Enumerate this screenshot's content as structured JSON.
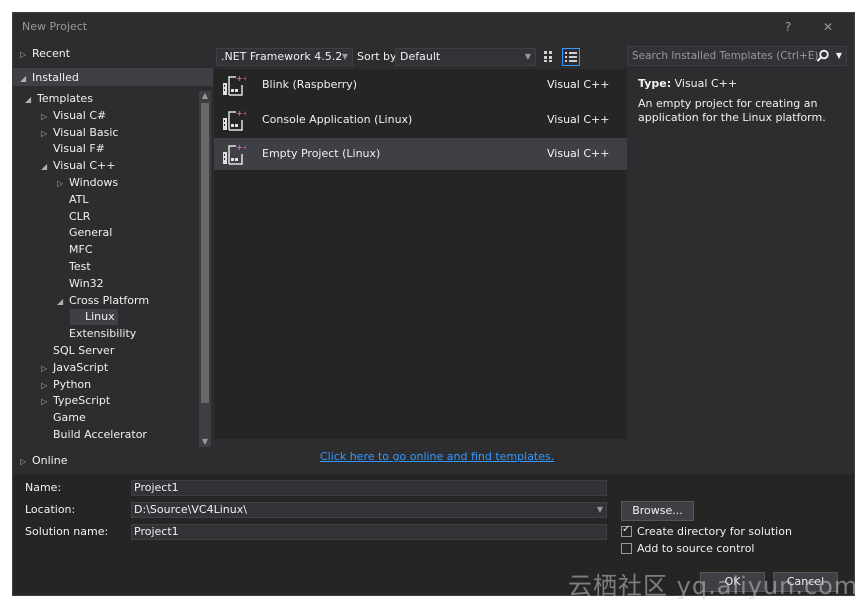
{
  "window": {
    "title": "New Project",
    "help_label": "?",
    "close_label": "✕"
  },
  "nav": {
    "recent": "Recent",
    "installed": "Installed",
    "online": "Online",
    "tree": [
      {
        "label": "Templates",
        "indent": 0,
        "arrow": "◢"
      },
      {
        "label": "Visual C#",
        "indent": 1,
        "arrow": "▷"
      },
      {
        "label": "Visual Basic",
        "indent": 1,
        "arrow": "▷"
      },
      {
        "label": "Visual F#",
        "indent": 1,
        "arrow": ""
      },
      {
        "label": "Visual C++",
        "indent": 1,
        "arrow": "◢"
      },
      {
        "label": "Windows",
        "indent": 2,
        "arrow": "▷"
      },
      {
        "label": "ATL",
        "indent": 2,
        "arrow": ""
      },
      {
        "label": "CLR",
        "indent": 2,
        "arrow": ""
      },
      {
        "label": "General",
        "indent": 2,
        "arrow": ""
      },
      {
        "label": "MFC",
        "indent": 2,
        "arrow": ""
      },
      {
        "label": "Test",
        "indent": 2,
        "arrow": ""
      },
      {
        "label": "Win32",
        "indent": 2,
        "arrow": ""
      },
      {
        "label": "Cross Platform",
        "indent": 2,
        "arrow": "◢"
      },
      {
        "label": "Linux",
        "indent": 3,
        "arrow": "",
        "selected": true
      },
      {
        "label": "Extensibility",
        "indent": 2,
        "arrow": ""
      },
      {
        "label": "SQL Server",
        "indent": 1,
        "arrow": ""
      },
      {
        "label": "JavaScript",
        "indent": 1,
        "arrow": "▷"
      },
      {
        "label": "Python",
        "indent": 1,
        "arrow": "▷"
      },
      {
        "label": "TypeScript",
        "indent": 1,
        "arrow": "▷"
      },
      {
        "label": "Game",
        "indent": 1,
        "arrow": ""
      },
      {
        "label": "Build Accelerator",
        "indent": 1,
        "arrow": ""
      }
    ]
  },
  "toolbar": {
    "framework": ".NET Framework 4.5.2",
    "sort_label": "Sort by:",
    "sort_value": "Default",
    "search_placeholder": "Search Installed Templates (Ctrl+E)"
  },
  "templates": [
    {
      "name": "Blink (Raspberry)",
      "lang": "Visual C++",
      "selected": false
    },
    {
      "name": "Console Application (Linux)",
      "lang": "Visual C++",
      "selected": false
    },
    {
      "name": "Empty Project (Linux)",
      "lang": "Visual C++",
      "selected": true
    }
  ],
  "detail": {
    "type_label": "Type:",
    "type_value": "Visual C++",
    "description": "An empty project for creating an application for the Linux platform."
  },
  "online_link": "Click here to go online and find templates.",
  "form": {
    "name_label": "Name:",
    "name_value": "Project1",
    "location_label": "Location:",
    "location_value": "D:\\Source\\VC4Linux\\",
    "solution_label": "Solution name:",
    "solution_value": "Project1",
    "browse_label": "Browse...",
    "create_dir_label": "Create directory for solution",
    "create_dir_checked": true,
    "source_control_label": "Add to source control",
    "source_control_checked": false,
    "ok_label": "OK",
    "cancel_label": "Cancel"
  },
  "watermark": "云栖社区 yq.aliyun.com",
  "colors": {
    "background": "#2d2d30",
    "panel": "#252526",
    "selection": "#3f3f46",
    "accent": "#3399ff",
    "icon_magenta": "#d060d0"
  }
}
